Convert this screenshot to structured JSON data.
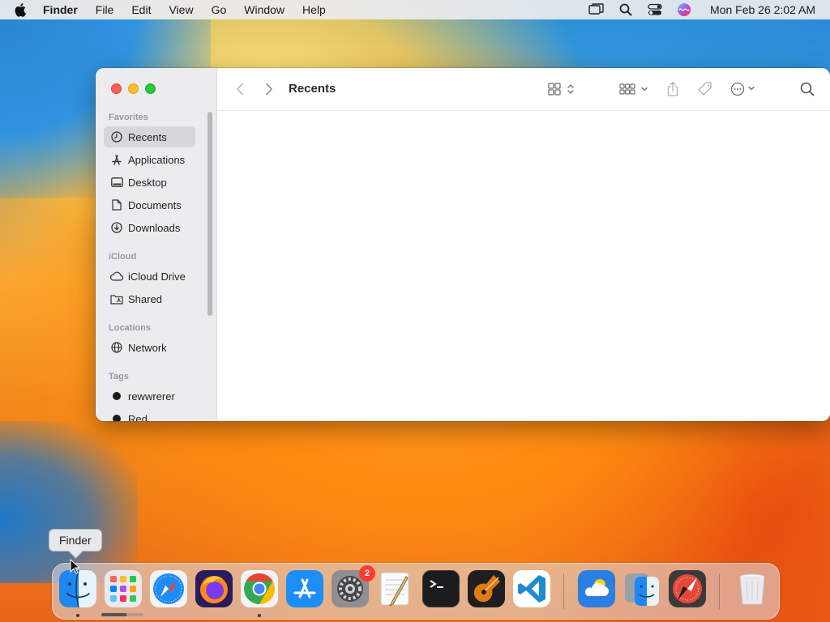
{
  "menubar": {
    "app_name": "Finder",
    "items": [
      "File",
      "Edit",
      "View",
      "Go",
      "Window",
      "Help"
    ],
    "clock": "Mon Feb 26  2:02 AM",
    "icons": [
      "apple-icon",
      "screen-mirroring-icon",
      "spotlight-search-icon",
      "control-center-icon",
      "siri-icon"
    ]
  },
  "window": {
    "title": "Recents",
    "sidebar": {
      "sections": [
        {
          "title": "Favorites",
          "items": [
            {
              "label": "Recents",
              "icon": "clock-icon",
              "selected": true
            },
            {
              "label": "Applications",
              "icon": "applications-icon"
            },
            {
              "label": "Desktop",
              "icon": "desktop-icon"
            },
            {
              "label": "Documents",
              "icon": "document-icon"
            },
            {
              "label": "Downloads",
              "icon": "downloads-icon"
            }
          ]
        },
        {
          "title": "iCloud",
          "items": [
            {
              "label": "iCloud Drive",
              "icon": "cloud-icon"
            },
            {
              "label": "Shared",
              "icon": "shared-folder-icon"
            }
          ]
        },
        {
          "title": "Locations",
          "items": [
            {
              "label": "Network",
              "icon": "globe-icon"
            }
          ]
        },
        {
          "title": "Tags",
          "items": [
            {
              "label": "rewwrerer",
              "icon": "tag-dot-icon",
              "color": "#1a1a1a"
            },
            {
              "label": "Red",
              "icon": "tag-dot-icon",
              "color": "#1a1a1a"
            }
          ]
        }
      ]
    },
    "toolbar": {
      "icons": [
        "back-icon",
        "forward-icon",
        "icon-view-icon",
        "group-by-icon",
        "share-icon",
        "tag-icon",
        "more-actions-icon",
        "search-icon"
      ]
    }
  },
  "dock": {
    "tooltip": "Finder",
    "apps": [
      {
        "name": "Finder",
        "running": true
      },
      {
        "name": "Launchpad",
        "running": false
      },
      {
        "name": "Safari",
        "running": false
      },
      {
        "name": "Firefox",
        "running": false
      },
      {
        "name": "Google Chrome",
        "running": true
      },
      {
        "name": "App Store",
        "running": false
      },
      {
        "name": "System Settings",
        "running": false,
        "badge": "2"
      },
      {
        "name": "TextEdit",
        "running": false
      },
      {
        "name": "Terminal",
        "running": false
      },
      {
        "name": "GarageBand",
        "running": false
      },
      {
        "name": "Visual Studio Code",
        "running": false
      },
      {
        "name": "Weather",
        "running": false
      },
      {
        "name": "Finder (Downloads)",
        "running": false
      },
      {
        "name": "Safari Technology Preview",
        "running": false
      },
      {
        "name": "Trash",
        "running": false
      }
    ],
    "launchpad_progress": 0.6,
    "colors": {
      "badge": "#ff3b30",
      "accent": "#0a84ff"
    }
  }
}
